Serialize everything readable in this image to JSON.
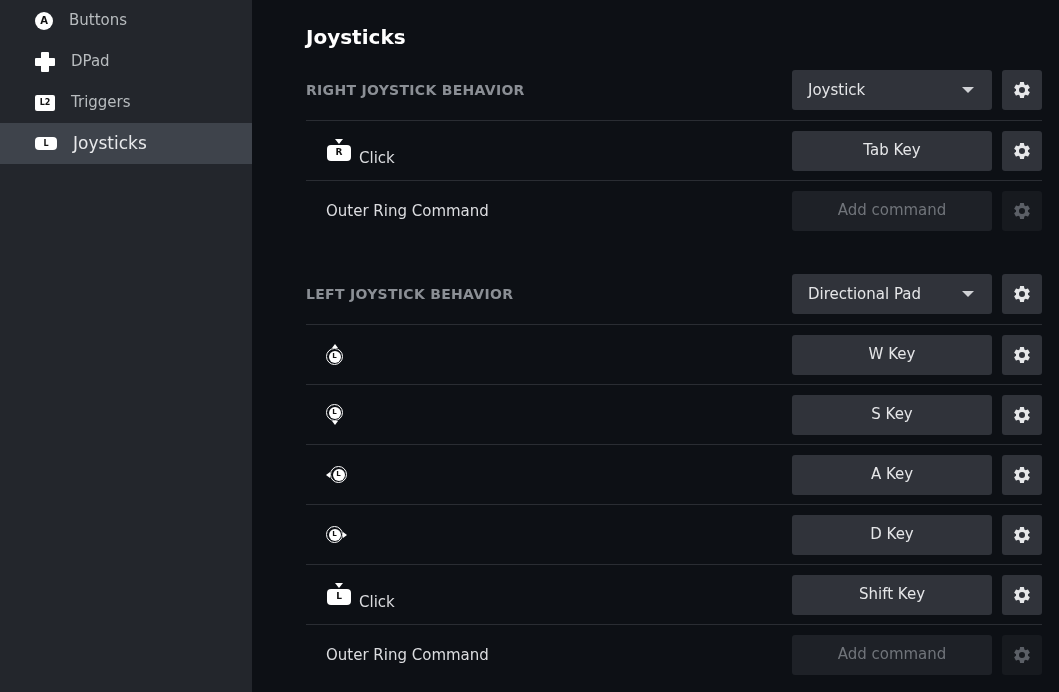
{
  "sidebar": {
    "items": [
      {
        "label": "Buttons",
        "icon": {
          "kind": "face",
          "letter": "A"
        },
        "selected": false
      },
      {
        "label": "DPad",
        "icon": {
          "kind": "dpad"
        },
        "selected": false
      },
      {
        "label": "Triggers",
        "icon": {
          "kind": "trigger",
          "letter": "L2"
        },
        "selected": false
      },
      {
        "label": "Joysticks",
        "icon": {
          "kind": "stick_click",
          "letter": "L"
        },
        "selected": true
      }
    ]
  },
  "main": {
    "title": "Joysticks",
    "sections": [
      {
        "heading": "RIGHT JOYSTICK BEHAVIOR",
        "mode": "Joystick",
        "rows": [
          {
            "icon": {
              "kind": "click",
              "letter": "R"
            },
            "label": "Click",
            "binding": "Tab Key",
            "disabled": false
          },
          {
            "label": "Outer Ring Command",
            "binding": "Add command",
            "disabled": true
          }
        ]
      },
      {
        "heading": "LEFT JOYSTICK BEHAVIOR",
        "mode": "Directional Pad",
        "rows": [
          {
            "icon": {
              "kind": "stick_up",
              "letter": "L"
            },
            "binding": "W Key",
            "disabled": false
          },
          {
            "icon": {
              "kind": "stick_down",
              "letter": "L"
            },
            "binding": "S Key",
            "disabled": false
          },
          {
            "icon": {
              "kind": "stick_left",
              "letter": "L"
            },
            "binding": "A Key",
            "disabled": false
          },
          {
            "icon": {
              "kind": "stick_right",
              "letter": "L"
            },
            "binding": "D Key",
            "disabled": false
          },
          {
            "icon": {
              "kind": "click",
              "letter": "L"
            },
            "label": "Click",
            "binding": "Shift Key",
            "disabled": false
          },
          {
            "label": "Outer Ring Command",
            "binding": "Add command",
            "disabled": true
          }
        ]
      }
    ]
  }
}
